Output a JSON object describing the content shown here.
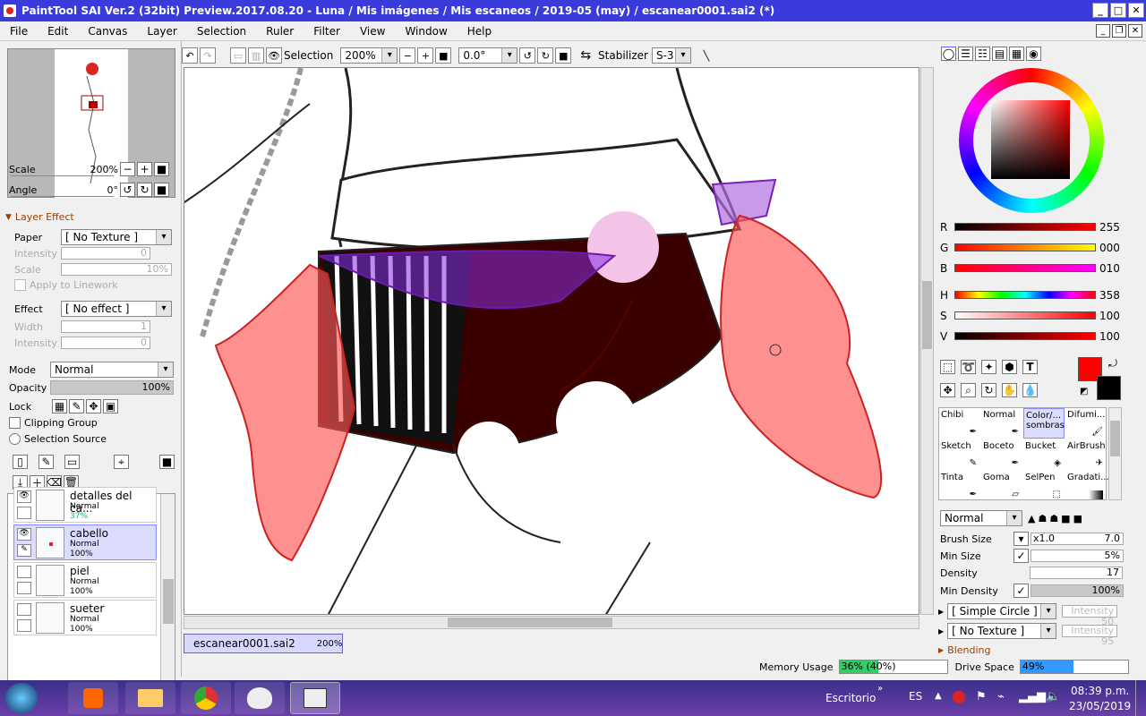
{
  "window": {
    "title": "PaintTool SAI Ver.2 (32bit) Preview.2017.08.20 - Luna / Mis imágenes / Mis escaneos / 2019-05 (may) / escanear0001.sai2 (*)"
  },
  "menu": [
    "File",
    "Edit",
    "Canvas",
    "Layer",
    "Selection",
    "Ruler",
    "Filter",
    "View",
    "Window",
    "Help"
  ],
  "navigator": {
    "scale_label": "Scale",
    "scale_value": "200%",
    "angle_label": "Angle",
    "angle_value": "0°"
  },
  "layer_effect": {
    "header": "Layer Effect",
    "paper_label": "Paper",
    "paper_value": "[ No Texture ]",
    "intensity_label": "Intensity",
    "intensity_value": "0",
    "scale_label": "Scale",
    "scale_value": "10%",
    "apply_label": "Apply to Linework",
    "effect_label": "Effect",
    "effect_value": "[ No effect ]",
    "width_label": "Width",
    "width_value": "1",
    "intensity2_label": "Intensity",
    "intensity2_value": "0"
  },
  "layer_props": {
    "mode_label": "Mode",
    "mode_value": "Normal",
    "opacity_label": "Opacity",
    "opacity_value": "100%",
    "lock_label": "Lock",
    "clipping_label": "Clipping Group",
    "selection_source_label": "Selection Source"
  },
  "layers": [
    {
      "name": "detalles del ca...",
      "mode": "Normal",
      "opacity": "37%"
    },
    {
      "name": "cabello",
      "mode": "Normal",
      "opacity": "100%"
    },
    {
      "name": "piel",
      "mode": "Normal",
      "opacity": "100%"
    },
    {
      "name": "sueter",
      "mode": "Normal",
      "opacity": "100%"
    }
  ],
  "toolbar": {
    "selection_label": "Selection",
    "zoom_value": "200%",
    "angle_value": "0.0°",
    "stabilizer_label": "Stabilizer",
    "stabilizer_value": "S-3"
  },
  "document_tab": {
    "name": "escanear0001.sai2",
    "zoom": "200%"
  },
  "color": {
    "r_label": "R",
    "r_value": "255",
    "g_label": "G",
    "g_value": "000",
    "b_label": "B",
    "b_value": "010",
    "h_label": "H",
    "h_value": "358",
    "s_label": "S",
    "s_value": "100",
    "v_label": "V",
    "v_value": "100",
    "primary": "#ff0000",
    "secondary": "#000000"
  },
  "tools": [
    {
      "name": "Chibi"
    },
    {
      "name": "Normal"
    },
    {
      "name": "Color/... sombras"
    },
    {
      "name": "Difumi..."
    },
    {
      "name": "Sketch"
    },
    {
      "name": "Boceto"
    },
    {
      "name": "Bucket"
    },
    {
      "name": "AirBrush"
    },
    {
      "name": "Tinta"
    },
    {
      "name": "Goma"
    },
    {
      "name": "SelPen"
    },
    {
      "name": "Gradati..."
    }
  ],
  "brush": {
    "mode_value": "Normal",
    "size_label": "Brush Size",
    "size_mult": "x1.0",
    "size_value": "7.0",
    "min_size_label": "Min Size",
    "min_size_value": "5%",
    "density_label": "Density",
    "density_value": "17",
    "min_density_label": "Min Density",
    "min_density_value": "100%",
    "shape_value": "[ Simple Circle ]",
    "shape_intensity": "Intensity 50",
    "texture_value": "[ No Texture ]",
    "texture_intensity": "Intensity 95",
    "blending_label": "Blending"
  },
  "status": {
    "memory_label": "Memory Usage",
    "memory_value": "36% (40%)",
    "memory_fraction": 0.36,
    "drive_label": "Drive Space",
    "drive_value": "49%",
    "drive_fraction": 0.49
  },
  "taskbar": {
    "desktop_label": "Escritorio",
    "lang": "ES",
    "time": "08:39 p.m.",
    "date": "23/05/2019"
  }
}
